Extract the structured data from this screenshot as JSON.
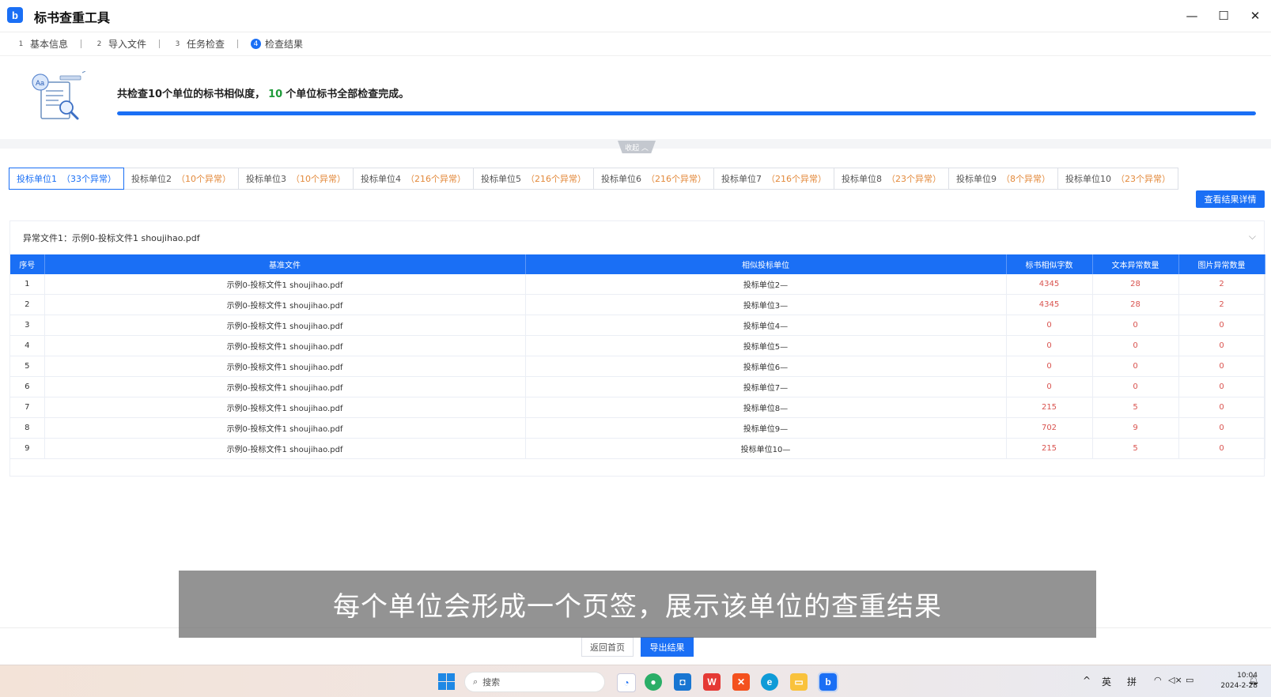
{
  "app": {
    "title": "标书查重工具",
    "logo_letter": "b"
  },
  "window_controls": [
    {
      "name": "minimize",
      "glyph": "—"
    },
    {
      "name": "maximize",
      "glyph": "☐"
    },
    {
      "name": "close",
      "glyph": "✕"
    }
  ],
  "steps": [
    {
      "num": "1",
      "label": "基本信息"
    },
    {
      "num": "2",
      "label": "导入文件"
    },
    {
      "num": "3",
      "label": "任务检查"
    },
    {
      "num": "4",
      "label": "检查结果",
      "active": true
    }
  ],
  "summary": {
    "prefix": "共检查10个单位的标书相似度，",
    "done_count": "10",
    "suffix": "个单位标书全部检查完成。",
    "progress_percent": 100
  },
  "collapse_label": "收起 ︿",
  "tabs": [
    {
      "label": "投标单位1",
      "count": "（33个异常）",
      "active": true
    },
    {
      "label": "投标单位2",
      "count": "（10个异常）"
    },
    {
      "label": "投标单位3",
      "count": "（10个异常）"
    },
    {
      "label": "投标单位4",
      "count": "（216个异常）"
    },
    {
      "label": "投标单位5",
      "count": "（216个异常）"
    },
    {
      "label": "投标单位6",
      "count": "（216个异常）"
    },
    {
      "label": "投标单位7",
      "count": "（216个异常）"
    },
    {
      "label": "投标单位8",
      "count": "（23个异常）"
    },
    {
      "label": "投标单位9",
      "count": "（8个异常）"
    },
    {
      "label": "投标单位10",
      "count": "（23个异常）"
    }
  ],
  "view_details_label": "查看结果详情",
  "panel": {
    "title": "异常文件1：示例0-投标文件1 shoujihao.pdf",
    "columns": [
      "序号",
      "基准文件",
      "相似投标单位",
      "标书相似字数",
      "文本异常数量",
      "图片异常数量"
    ],
    "rows": [
      [
        "1",
        "示例0-投标文件1 shoujihao.pdf",
        "投标单位2—",
        "4345",
        "28",
        "2"
      ],
      [
        "2",
        "示例0-投标文件1 shoujihao.pdf",
        "投标单位3—",
        "4345",
        "28",
        "2"
      ],
      [
        "3",
        "示例0-投标文件1 shoujihao.pdf",
        "投标单位4—",
        "0",
        "0",
        "0"
      ],
      [
        "4",
        "示例0-投标文件1 shoujihao.pdf",
        "投标单位5—",
        "0",
        "0",
        "0"
      ],
      [
        "5",
        "示例0-投标文件1 shoujihao.pdf",
        "投标单位6—",
        "0",
        "0",
        "0"
      ],
      [
        "6",
        "示例0-投标文件1 shoujihao.pdf",
        "投标单位7—",
        "0",
        "0",
        "0"
      ],
      [
        "7",
        "示例0-投标文件1 shoujihao.pdf",
        "投标单位8—",
        "215",
        "5",
        "0"
      ],
      [
        "8",
        "示例0-投标文件1 shoujihao.pdf",
        "投标单位9—",
        "702",
        "9",
        "0"
      ],
      [
        "9",
        "示例0-投标文件1 shoujihao.pdf",
        "投标单位10—",
        "215",
        "5",
        "0"
      ]
    ]
  },
  "caption": "每个单位会形成一个页签，展示该单位的查重结果",
  "footer": {
    "back_label": "返回首页",
    "export_label": "导出结果"
  },
  "taskbar": {
    "search_placeholder": "搜索",
    "tray": {
      "chevron": "^",
      "lang": "英",
      "ime": "拼"
    },
    "clock_time": "10:04",
    "clock_date": "2024-2-28"
  },
  "colors": {
    "accent": "#1a6ff5",
    "success": "#1f9b3a",
    "warning": "#e38a3c",
    "danger": "#d9534f"
  }
}
